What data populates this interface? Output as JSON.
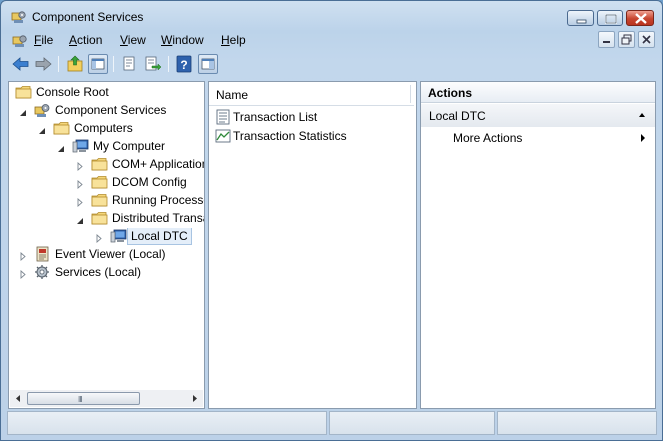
{
  "window": {
    "title": "Component Services"
  },
  "menu": {
    "items": [
      {
        "label": "File",
        "mnemonic": "F",
        "rest": "ile"
      },
      {
        "label": "Action",
        "mnemonic": "A",
        "rest": "ction"
      },
      {
        "label": "View",
        "mnemonic": "V",
        "rest": "iew"
      },
      {
        "label": "Window",
        "mnemonic": "W",
        "rest": "indow"
      },
      {
        "label": "Help",
        "mnemonic": "H",
        "rest": "elp"
      }
    ]
  },
  "tree": {
    "items": [
      {
        "label": "Console Root",
        "icon": "folder-icon",
        "expander": "none"
      },
      {
        "label": "Component Services",
        "icon": "component-services-icon",
        "expander": "expanded"
      },
      {
        "label": "Computers",
        "icon": "folder-icon",
        "expander": "expanded"
      },
      {
        "label": "My Computer",
        "icon": "computer-icon",
        "expander": "expanded"
      },
      {
        "label": "COM+ Applications",
        "icon": "folder-icon",
        "expander": "collapsed"
      },
      {
        "label": "DCOM Config",
        "icon": "folder-icon",
        "expander": "collapsed"
      },
      {
        "label": "Running Processes",
        "icon": "folder-icon",
        "expander": "collapsed"
      },
      {
        "label": "Distributed Transaction Coordinator",
        "icon": "folder-icon",
        "expander": "expanded"
      },
      {
        "label": "Local DTC",
        "icon": "computer-icon",
        "expander": "collapsed",
        "selected": true
      },
      {
        "label": "Event Viewer (Local)",
        "icon": "event-viewer-icon",
        "expander": "collapsed"
      },
      {
        "label": "Services (Local)",
        "icon": "gear-icon",
        "expander": "collapsed"
      }
    ],
    "scroll_grip": "III"
  },
  "list": {
    "column_header": "Name",
    "items": [
      {
        "label": "Transaction List",
        "icon": "list-icon"
      },
      {
        "label": "Transaction Statistics",
        "icon": "statistics-icon"
      }
    ]
  },
  "actions": {
    "title": "Actions",
    "section": "Local DTC",
    "items": [
      {
        "label": "More Actions"
      }
    ]
  },
  "colors": {
    "selection": "#e4eef9",
    "close_button": "#c7452f",
    "folder": "#f5d77a"
  }
}
